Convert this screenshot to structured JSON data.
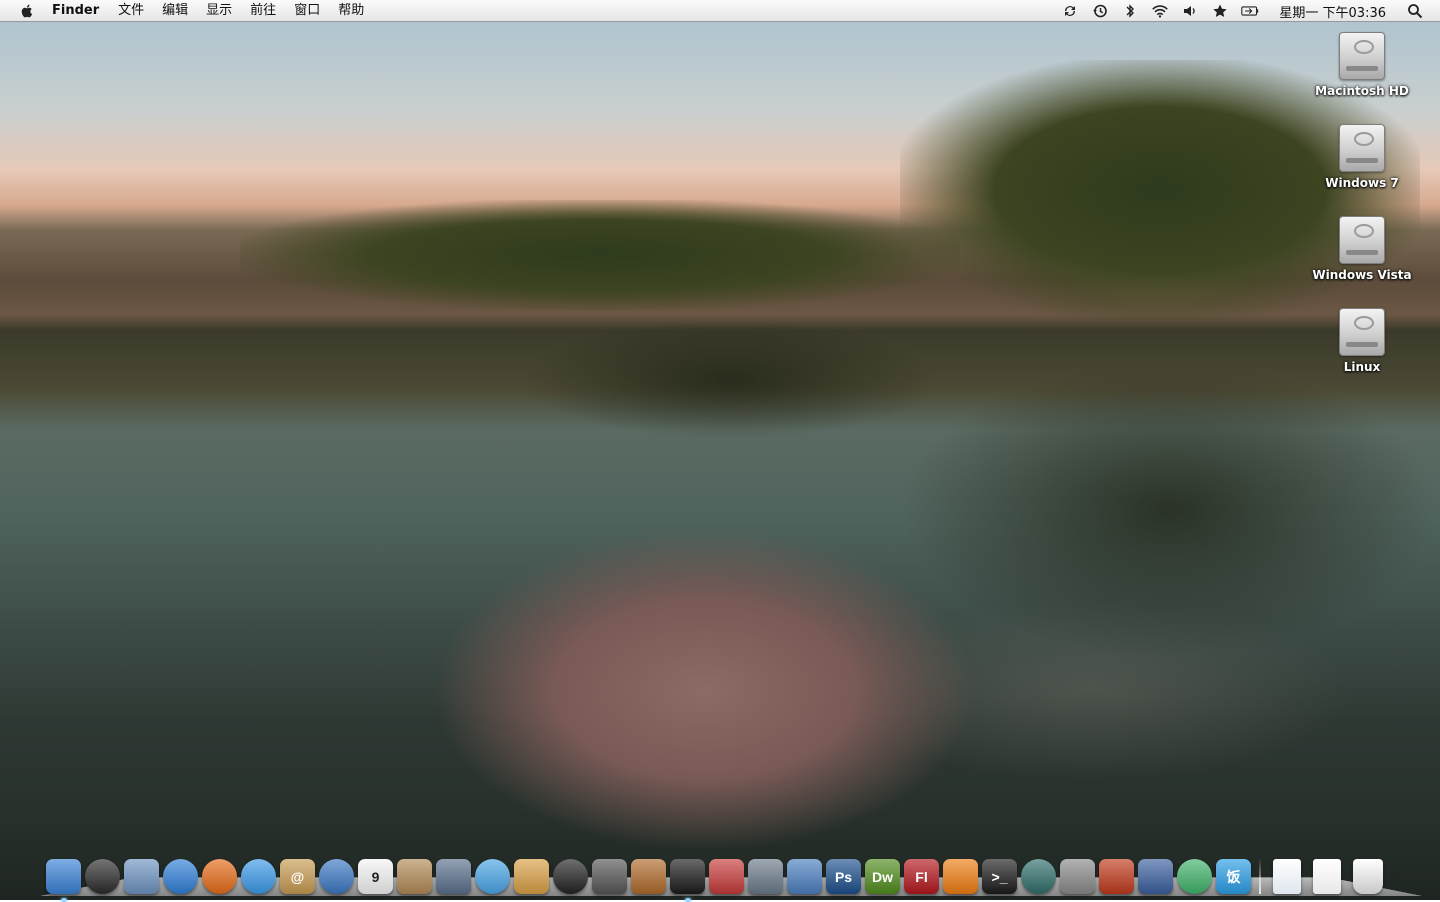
{
  "menubar": {
    "apple": "apple-logo-icon",
    "app_name": "Finder",
    "menus": [
      "文件",
      "编辑",
      "显示",
      "前往",
      "窗口",
      "帮助"
    ],
    "status_icons": [
      "sync-icon",
      "time-machine-icon",
      "bluetooth-icon",
      "wifi-icon",
      "volume-icon",
      "favorites-star-icon",
      "battery-icon"
    ],
    "clock": "星期一 下午03:36",
    "spotlight": "spotlight-search-icon"
  },
  "desktop": {
    "icons": [
      {
        "label": "Macintosh HD",
        "icon": "hard-drive-icon"
      },
      {
        "label": "Windows 7",
        "icon": "hard-drive-icon"
      },
      {
        "label": "Windows Vista",
        "icon": "hard-drive-icon"
      },
      {
        "label": "Linux",
        "icon": "hard-drive-icon"
      }
    ]
  },
  "dock": {
    "apps": [
      {
        "name": "finder-icon",
        "color": "#3a82d6",
        "text": ""
      },
      {
        "name": "dashboard-icon",
        "color": "#2b2b2b",
        "text": ""
      },
      {
        "name": "mail-icon",
        "color": "#6d93c0",
        "text": ""
      },
      {
        "name": "safari-icon",
        "color": "#2f7fd8",
        "text": ""
      },
      {
        "name": "firefox-icon",
        "color": "#e66b17",
        "text": ""
      },
      {
        "name": "ichat-icon",
        "color": "#3b9ae8",
        "text": ""
      },
      {
        "name": "address-book-icon",
        "color": "#c79b52",
        "text": "@"
      },
      {
        "name": "network-globe-icon",
        "color": "#3c78c4",
        "text": ""
      },
      {
        "name": "ical-icon",
        "color": "#f4f4f4",
        "text": "9"
      },
      {
        "name": "utility-box-icon",
        "color": "#b28a55",
        "text": ""
      },
      {
        "name": "preview-photos-icon",
        "color": "#5a6f8c",
        "text": ""
      },
      {
        "name": "itunes-icon",
        "color": "#49a5e6",
        "text": ""
      },
      {
        "name": "iphoto-icon",
        "color": "#d9a044",
        "text": ""
      },
      {
        "name": "photo-booth-icon",
        "color": "#222222",
        "text": ""
      },
      {
        "name": "imovie-star-icon",
        "color": "#555555",
        "text": ""
      },
      {
        "name": "garageband-icon",
        "color": "#b06a2a",
        "text": ""
      },
      {
        "name": "qq-penguin-icon",
        "color": "#1a1a1a",
        "text": ""
      },
      {
        "name": "parallels-icon",
        "color": "#c73a3a",
        "text": ""
      },
      {
        "name": "spaces-icon",
        "color": "#6a7a8a",
        "text": ""
      },
      {
        "name": "xcode-icon",
        "color": "#4a7fc0",
        "text": ""
      },
      {
        "name": "photoshop-icon",
        "color": "#1c4f8c",
        "text": "Ps"
      },
      {
        "name": "dreamweaver-icon",
        "color": "#4f8c1c",
        "text": "Dw"
      },
      {
        "name": "flash-icon",
        "color": "#b3161c",
        "text": "Fl"
      },
      {
        "name": "vlc-icon",
        "color": "#ee7d11",
        "text": ""
      },
      {
        "name": "terminal-icon",
        "color": "#1b1b1b",
        "text": ">_"
      },
      {
        "name": "time-machine-app-icon",
        "color": "#2f6e6a",
        "text": ""
      },
      {
        "name": "system-preferences-icon",
        "color": "#8a8a8a",
        "text": ""
      },
      {
        "name": "fireworks-flame-icon",
        "color": "#c0391b",
        "text": ""
      },
      {
        "name": "pen-tool-icon",
        "color": "#3a5fa0",
        "text": ""
      },
      {
        "name": "swirl-app-icon",
        "color": "#3fb36a",
        "text": ""
      },
      {
        "name": "fan-app-icon",
        "color": "#2a9ee6",
        "text": "饭"
      }
    ],
    "docs": [
      {
        "name": "documents-stack-icon",
        "color": "#dfe6ef"
      },
      {
        "name": "downloads-stack-icon",
        "color": "#e8e8e8"
      },
      {
        "name": "trash-icon",
        "color": "#c8c8c8"
      }
    ]
  }
}
